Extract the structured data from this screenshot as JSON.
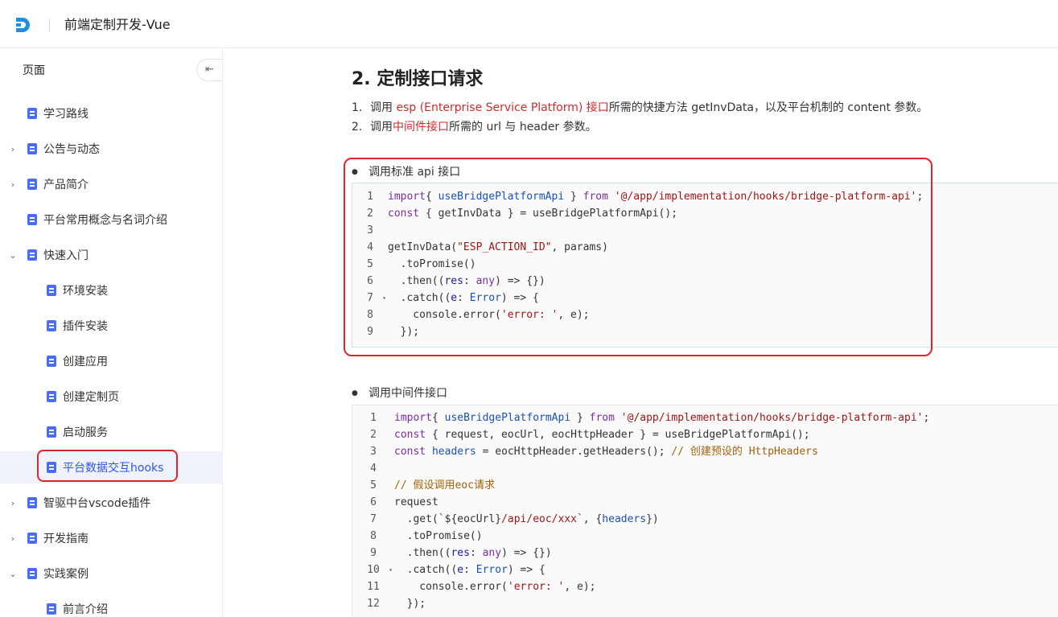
{
  "header": {
    "title": "前端定制开发-Vue"
  },
  "sidebar": {
    "header_label": "页面",
    "collapse_icon_glyph": "⇤",
    "items": [
      {
        "label": "学习路线",
        "indent": 0,
        "chevron": "",
        "active": false
      },
      {
        "label": "公告与动态",
        "indent": 0,
        "chevron": "›",
        "active": false
      },
      {
        "label": "产品简介",
        "indent": 0,
        "chevron": "›",
        "active": false
      },
      {
        "label": "平台常用概念与名词介绍",
        "indent": 0,
        "chevron": "",
        "active": false
      },
      {
        "label": "快速入门",
        "indent": 0,
        "chevron": "⌄",
        "active": false
      },
      {
        "label": "环境安装",
        "indent": 1,
        "chevron": "",
        "active": false
      },
      {
        "label": "插件安装",
        "indent": 1,
        "chevron": "",
        "active": false
      },
      {
        "label": "创建应用",
        "indent": 1,
        "chevron": "",
        "active": false
      },
      {
        "label": "创建定制页",
        "indent": 1,
        "chevron": "",
        "active": false
      },
      {
        "label": "启动服务",
        "indent": 1,
        "chevron": "",
        "active": false
      },
      {
        "label": "平台数据交互hooks",
        "indent": 1,
        "chevron": "",
        "active": true
      },
      {
        "label": "智驱中台vscode插件",
        "indent": 0,
        "chevron": "›",
        "active": false
      },
      {
        "label": "开发指南",
        "indent": 0,
        "chevron": "›",
        "active": false
      },
      {
        "label": "实践案例",
        "indent": 0,
        "chevron": "⌄",
        "active": false
      },
      {
        "label": "前言介绍",
        "indent": 1,
        "chevron": "",
        "active": false
      }
    ]
  },
  "main": {
    "heading": "2.  定制接口请求",
    "list": [
      {
        "num": "1.",
        "pre": "调用 ",
        "link": "esp (Enterprise Service Platform) 接口",
        "post": "所需的快捷方法 getInvData，以及平台机制的 content 参数。"
      },
      {
        "num": "2.",
        "pre": "调用",
        "link": "中间件接口",
        "post": "所需的 url 与 header 参数。"
      }
    ],
    "section1": {
      "bullet": "●",
      "label": "调用标准 api 接口"
    },
    "section2": {
      "bullet": "●",
      "label": "调用中间件接口"
    }
  },
  "code1": [
    {
      "n": "1",
      "fold": "",
      "tokens": [
        [
          "k",
          "import"
        ],
        [
          "",
          "{ "
        ],
        [
          "t",
          "useBridgePlatformApi"
        ],
        [
          "",
          " } "
        ],
        [
          "k",
          "from"
        ],
        [
          "",
          " "
        ],
        [
          "s",
          "'@/app/implementation/hooks/bridge-platform-api'"
        ],
        [
          "",
          ";"
        ]
      ]
    },
    {
      "n": "2",
      "fold": "",
      "tokens": [
        [
          "k",
          "const"
        ],
        [
          "",
          " { getInvData } = useBridgePlatformApi();"
        ]
      ]
    },
    {
      "n": "3",
      "fold": "",
      "tokens": []
    },
    {
      "n": "4",
      "fold": "",
      "tokens": [
        [
          "",
          "getInvData("
        ],
        [
          "s",
          "\"ESP_ACTION_ID\""
        ],
        [
          "",
          ", params)"
        ]
      ]
    },
    {
      "n": "5",
      "fold": "",
      "tokens": [
        [
          "",
          "  .toPromise()"
        ]
      ]
    },
    {
      "n": "6",
      "fold": "",
      "tokens": [
        [
          "",
          "  .then(("
        ],
        [
          "p",
          "res"
        ],
        [
          "",
          ": "
        ],
        [
          "k",
          "any"
        ],
        [
          "",
          ") => {})"
        ]
      ]
    },
    {
      "n": "7",
      "fold": "▾",
      "tokens": [
        [
          "",
          "  .catch(("
        ],
        [
          "p",
          "e"
        ],
        [
          "",
          ": "
        ],
        [
          "t",
          "Error"
        ],
        [
          "",
          ") => {"
        ]
      ]
    },
    {
      "n": "8",
      "fold": "",
      "tokens": [
        [
          "",
          "    console.error("
        ],
        [
          "s",
          "'error: '"
        ],
        [
          "",
          ", e);"
        ]
      ]
    },
    {
      "n": "9",
      "fold": "",
      "tokens": [
        [
          "",
          "  });"
        ]
      ]
    }
  ],
  "code2": [
    {
      "n": "1",
      "fold": "",
      "tokens": [
        [
          "k",
          "import"
        ],
        [
          "",
          "{ "
        ],
        [
          "t",
          "useBridgePlatformApi"
        ],
        [
          "",
          " } "
        ],
        [
          "k",
          "from"
        ],
        [
          "",
          " "
        ],
        [
          "s",
          "'@/app/implementation/hooks/bridge-platform-api'"
        ],
        [
          "",
          ";"
        ]
      ]
    },
    {
      "n": "2",
      "fold": "",
      "tokens": [
        [
          "k",
          "const"
        ],
        [
          "",
          " { request, eocUrl, eocHttpHeader } = useBridgePlatformApi();"
        ]
      ]
    },
    {
      "n": "3",
      "fold": "",
      "tokens": [
        [
          "k",
          "const"
        ],
        [
          "",
          " "
        ],
        [
          "t",
          "headers"
        ],
        [
          "",
          " = eocHttpHeader.getHeaders(); "
        ],
        [
          "c",
          "// 创建预设的 HttpHeaders"
        ]
      ]
    },
    {
      "n": "4",
      "fold": "",
      "tokens": []
    },
    {
      "n": "5",
      "fold": "",
      "tokens": [
        [
          "c",
          "// 假设调用eoc请求"
        ]
      ]
    },
    {
      "n": "6",
      "fold": "",
      "tokens": [
        [
          "",
          "request"
        ]
      ]
    },
    {
      "n": "7",
      "fold": "",
      "tokens": [
        [
          "",
          "  .get(`${eocUrl}"
        ],
        [
          "s",
          "/api/eoc/xxx"
        ],
        [
          "",
          "`, {"
        ],
        [
          "t",
          "headers"
        ],
        [
          "",
          "})"
        ]
      ]
    },
    {
      "n": "8",
      "fold": "",
      "tokens": [
        [
          "",
          "  .toPromise()"
        ]
      ]
    },
    {
      "n": "9",
      "fold": "",
      "tokens": [
        [
          "",
          "  .then(("
        ],
        [
          "p",
          "res"
        ],
        [
          "",
          ": "
        ],
        [
          "k",
          "any"
        ],
        [
          "",
          ") => {})"
        ]
      ]
    },
    {
      "n": "10",
      "fold": "▾",
      "tokens": [
        [
          "",
          "  .catch(("
        ],
        [
          "p",
          "e"
        ],
        [
          "",
          ": "
        ],
        [
          "t",
          "Error"
        ],
        [
          "",
          ") => {"
        ]
      ]
    },
    {
      "n": "11",
      "fold": "",
      "tokens": [
        [
          "",
          "    console.error("
        ],
        [
          "s",
          "'error: '"
        ],
        [
          "",
          ", e);"
        ]
      ]
    },
    {
      "n": "12",
      "fold": "",
      "tokens": [
        [
          "",
          "  });"
        ]
      ]
    }
  ]
}
